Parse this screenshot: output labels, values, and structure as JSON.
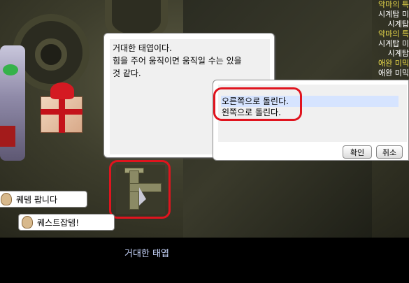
{
  "dialog": {
    "lines": [
      "거대한 태엽이다.",
      "힘을 주어 움직이면 움직일 수는 있을",
      "것 같다."
    ]
  },
  "menu": {
    "options": [
      "오른쪽으로 돌린다.",
      "왼쪽으로 돌린다."
    ],
    "ok_label": "확인",
    "cancel_label": "취소"
  },
  "vendors": [
    {
      "label": "퀘템 팝니다"
    },
    {
      "label": "퀘스트잡템!"
    }
  ],
  "object_name": "거대한 태엽",
  "side_text": [
    {
      "text": "악마의 특",
      "color": "#e8d84a"
    },
    {
      "text": "시계탑 미",
      "color": "#ffffff"
    },
    {
      "text": "시계탑",
      "color": "#ffffff"
    },
    {
      "text": "",
      "color": "#ffffff"
    },
    {
      "text": "악마의 특",
      "color": "#e8d84a"
    },
    {
      "text": "시계탑 미",
      "color": "#ffffff"
    },
    {
      "text": "시계탑",
      "color": "#ffffff"
    },
    {
      "text": "",
      "color": "#ffffff"
    },
    {
      "text": "애완 미믹",
      "color": "#e8d84a"
    },
    {
      "text": "애완 미믹",
      "color": "#ffffff"
    }
  ],
  "colors": {
    "highlight_outline": "#e0141e",
    "selected_option_bg": "#d6e4ff",
    "caption_text": "#c9d7ff"
  }
}
